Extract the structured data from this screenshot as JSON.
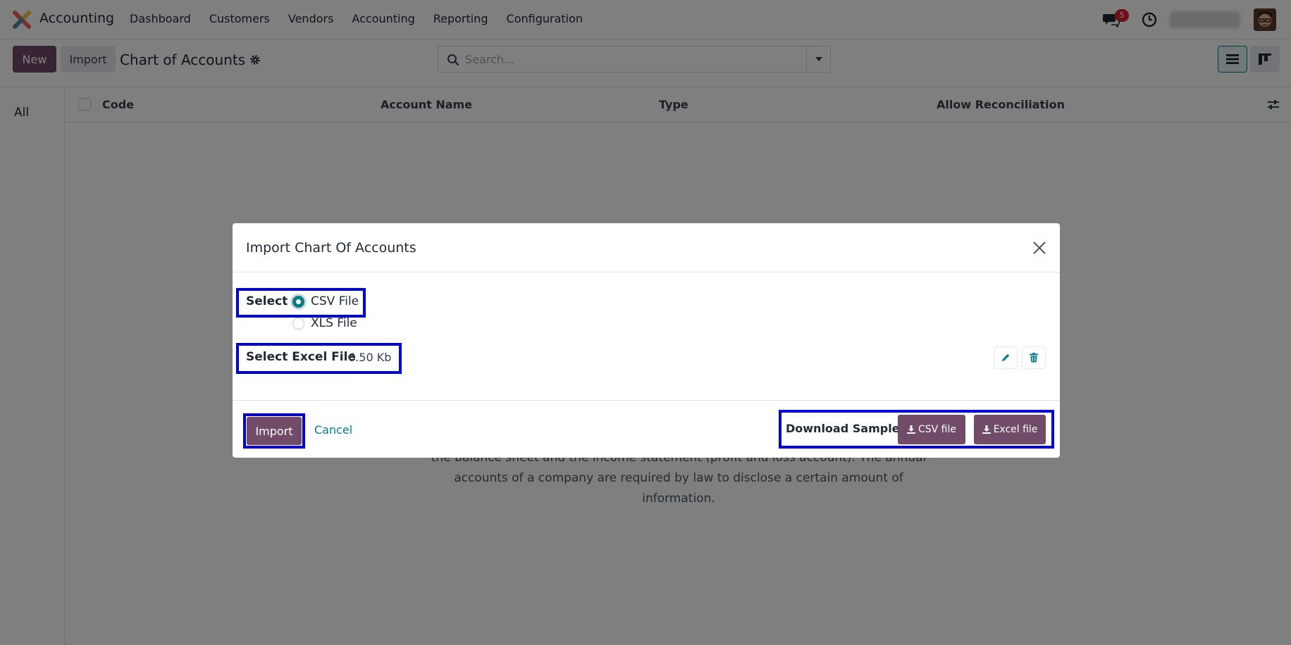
{
  "navbar": {
    "app_name": "Accounting",
    "menu": [
      "Dashboard",
      "Customers",
      "Vendors",
      "Accounting",
      "Reporting",
      "Configuration"
    ],
    "chat_badge": "5",
    "accent": "#714b67"
  },
  "control": {
    "new_label": "New",
    "import_label": "Import",
    "title": "Chart of Accounts",
    "search_placeholder": "Search..."
  },
  "sidebar": {
    "all_label": "All"
  },
  "list": {
    "columns": [
      "Code",
      "Account Name",
      "Type",
      "Allow Reconciliation"
    ]
  },
  "help_text": "the balance sheet and the income statement (profit and loss account). The annual accounts of a company are required by law to disclose a certain amount of information.",
  "modal": {
    "title": "Import Chart Of Accounts",
    "select_label": "Select",
    "options": [
      "CSV File",
      "XLS File"
    ],
    "selected_option": "CSV File",
    "file_label": "Select Excel File",
    "file_size": "6.50 Kb",
    "import_label": "Import",
    "cancel_label": "Cancel",
    "download_label": "Download Sample:",
    "csv_btn": "CSV file",
    "excel_btn": "Excel file",
    "link_color": "#017e84",
    "highlight_color": "#0000d8"
  }
}
